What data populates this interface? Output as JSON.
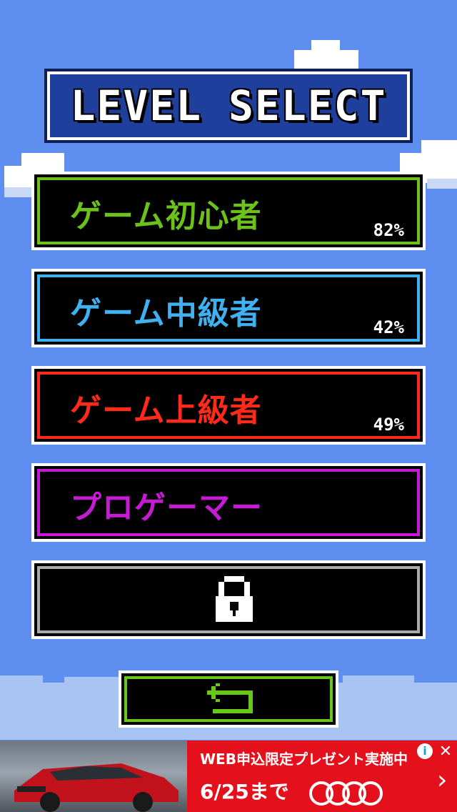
{
  "title": "LEVEL SELECT",
  "colors": {
    "background": "#5d8ef0",
    "beginner": "#6cc21a",
    "intermediate": "#3fb0f0",
    "advanced": "#ff2a1a",
    "pro": "#c81ad6",
    "locked": "#aaaaaa",
    "back": "#67c81a"
  },
  "levels": [
    {
      "label": "ゲーム初心者",
      "percent": "82%",
      "color": "#6cc21a"
    },
    {
      "label": "ゲーム中級者",
      "percent": "42%",
      "color": "#3fb0f0"
    },
    {
      "label": "ゲーム上級者",
      "percent": "49%",
      "color": "#ff2a1a"
    },
    {
      "label": "プロゲーマー",
      "percent": "",
      "color": "#c81ad6"
    },
    {
      "label": "",
      "percent": "",
      "color": "#aaaaaa",
      "icon": "lock-icon"
    }
  ],
  "back_button": {
    "icon": "return-arrow-icon"
  },
  "ad": {
    "headline": "WEB申込限定プレゼント実施中",
    "sub": "6/25まで",
    "logo": "audi-logo",
    "info_icon": "i",
    "close_icon": "✕",
    "arrow_icon": "›"
  }
}
